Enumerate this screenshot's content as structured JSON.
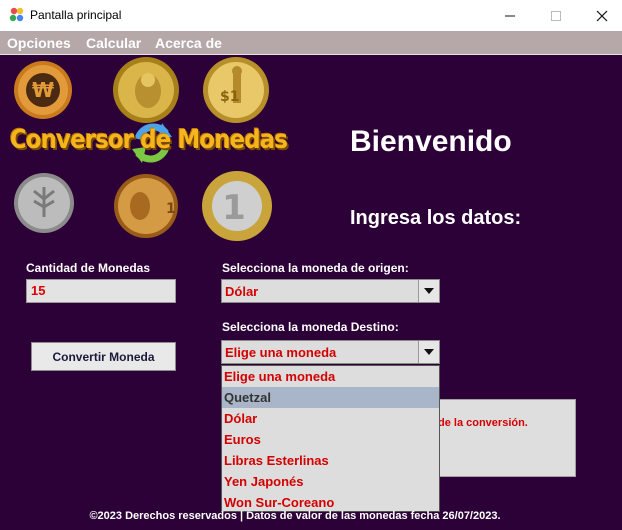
{
  "window": {
    "title": "Pantalla principal"
  },
  "menu": {
    "options": "Opciones",
    "calculate": "Calcular",
    "about": "Acerca de"
  },
  "brand": {
    "line": "Conversor de Monedas"
  },
  "welcome": "Bienvenido",
  "subtitle": "Ingresa los datos:",
  "amount": {
    "label": "Cantidad de Monedas",
    "value": "15"
  },
  "origin": {
    "label": "Selecciona la moneda de origen:",
    "selected": "Dólar"
  },
  "destination": {
    "label": "Selecciona la moneda Destino:",
    "selected": "Elige una moneda",
    "options": [
      "Elige una moneda",
      "Quetzal",
      "Dólar",
      "Euros",
      "Libras Esterlinas",
      "Yen Japonés",
      "Won Sur-Coreano"
    ],
    "highlighted": "Quetzal"
  },
  "convert_button": "Convertir Moneda",
  "result_fragment": "de la conversión.",
  "footer": "©2023 Derechos reservados | Datos de valor de las monedas fecha 26/07/2023.",
  "coins": [
    "won-coin",
    "pound-coin",
    "dollar-coin",
    "yen-coin",
    "one-coin",
    "euro-coin"
  ],
  "colors": {
    "background": "#2c0137",
    "menubar": "#b6a8a8",
    "accent_red": "#d40000",
    "brand_gold": "#f6b51c"
  }
}
